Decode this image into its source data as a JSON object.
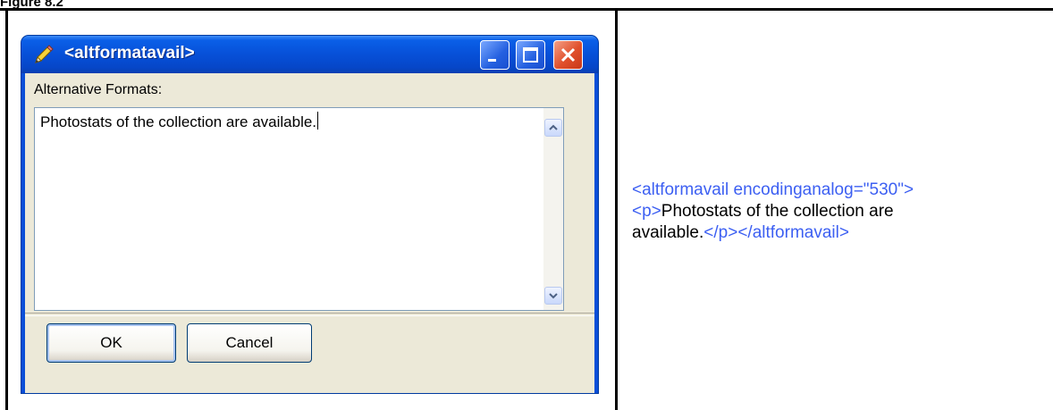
{
  "figure": {
    "label": "Figure 8.2"
  },
  "dialog": {
    "title": "<altformatavail>",
    "field_label": "Alternative Formats:",
    "text_value": "Photostats of the collection are available.",
    "ok_label": "OK",
    "cancel_label": "Cancel"
  },
  "xml_example": {
    "open_tag": "<altformavail encodinganalog=\"530\">",
    "p_open": "<p>",
    "text_line1": "Photostats of the collection are",
    "text_line2": "available.",
    "p_close": "</p>",
    "close_tag": "</altformavail>"
  },
  "colors": {
    "tag": "#3c5ff2",
    "titlebar": "#0750d8",
    "dialog_bg": "#ece9d8"
  },
  "icons": [
    "pencil-icon",
    "minimize-icon",
    "maximize-icon",
    "close-icon",
    "scroll-up-icon",
    "scroll-down-icon"
  ]
}
